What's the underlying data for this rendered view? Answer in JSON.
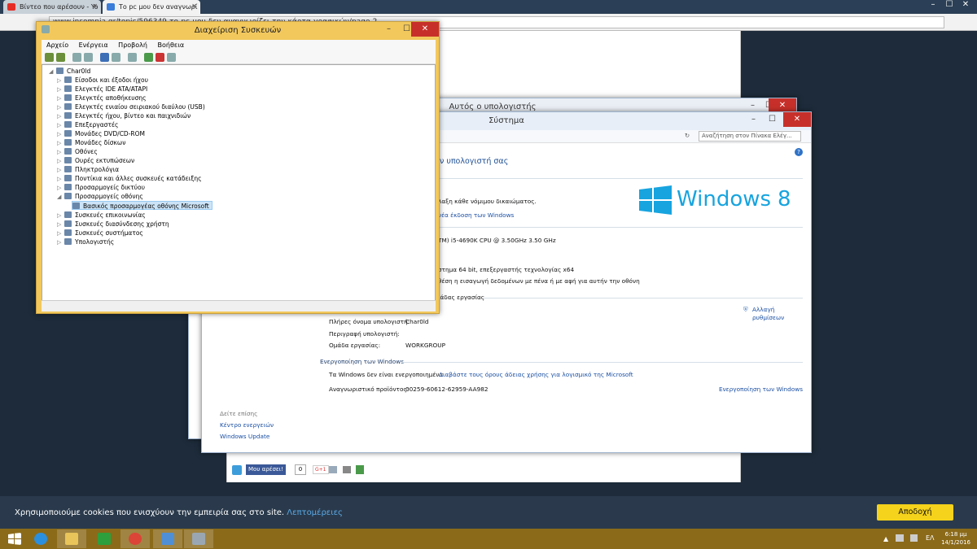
{
  "browser": {
    "tabs": [
      {
        "label": "Βίντεο που αρέσουν - Yo",
        "favicon_color": "#e52d27"
      },
      {
        "label": "Το pc μου δεν αναγνωρί",
        "favicon_color": "#3b7dd8"
      }
    ],
    "address": "www.insomnia.gr/topic/596349-το-pc-μου-δεν-αναγνωρίζει-την-κάρτα-γραφικών/page-2",
    "cookie_text": "Χρησιμοποιούμε cookies που ενισχύουν την εμπειρία σας στο site.",
    "cookie_link": "Λεπτομέρειες",
    "cookie_button": "Αποδοχή",
    "social_like": "Μου αρέσει!",
    "social_count": "0",
    "social_gplus": "G+1"
  },
  "device_manager": {
    "title": "Διαχείριση Συσκευών",
    "menu": [
      "Αρχείο",
      "Ενέργεια",
      "Προβολή",
      "Βοήθεια"
    ],
    "root": "Char0ld",
    "nodes": [
      "Είσοδοι και έξοδοι ήχου",
      "Ελεγκτές IDE ATA/ATAPI",
      "Ελεγκτές αποθήκευσης",
      "Ελεγκτές ενιαίου σειριακού διαύλου (USB)",
      "Ελεγκτές ήχου, βίντεο και παιχνιδιών",
      "Επεξεργαστές",
      "Μονάδες DVD/CD-ROM",
      "Μονάδες δίσκων",
      "Οθόνες",
      "Ουρές εκτυπώσεων",
      "Πληκτρολόγια",
      "Ποντίκια και άλλες συσκευές κατάδειξης",
      "Προσαρμογείς δικτύου",
      "Προσαρμογείς οθόνης",
      "Βασικός προσαρμογέας οθόνης Microsoft",
      "Συσκευές επικοινωνίας",
      "Συσκευές διασύνδεσης χρήστη",
      "Συσκευές συστήματος",
      "Υπολογιστής"
    ]
  },
  "this_pc": {
    "title": "Αυτός ο υπολογιστής"
  },
  "system": {
    "title": "Σύστημα",
    "search_placeholder": "Αναζήτηση στον Πίνακα Ελέγ...",
    "heading": "ν υπολογιστή σας",
    "rights": "λαξη κάθε νόμιμου δικαιώματος.",
    "new_edition": "νέα έκδοση των Windows",
    "logo": "Windows",
    "logo_ver": "8",
    "cpu": "TM) i5-4690K CPU @ 3.50GHz   3.50 GHz",
    "os_type": "στημα 64 bit, επεξεργαστής τεχνολογίας x64",
    "pen": "θέση η εισαγωγή δεδομένων με πένα ή με αφή για αυτήν την οθόνη",
    "workgroup_section": "ιάδας εργασίας",
    "change_settings": "Αλλαγή ρυθμίσεων",
    "full_name_label": "Πλήρες όνομα υπολογιστή:",
    "full_name": "Char0ld",
    "description_label": "Περιγραφή υπολογιστή:",
    "workgroup_label": "Ομάδα εργασίας:",
    "workgroup": "WORKGROUP",
    "activation_header": "Ενεργοποίηση των Windows",
    "activation_status": "Τα Windows δεν είναι ενεργοποιημένα.",
    "license_link": "Διαβάστε τους όρους άδειας χρήσης για λογισμικό της Microsoft",
    "product_id_label": "Αναγνωριστικό προϊόντος:",
    "product_id": "00259-60612-62959-AA982",
    "activate_link": "Ενεργοποίηση των Windows",
    "see_also": "Δείτε επίσης",
    "action_center": "Κέντρο ενεργειών",
    "windows_update": "Windows Update"
  },
  "taskbar": {
    "lang": "ΕΛ",
    "time": "6:18 μμ",
    "date": "14/1/2016"
  }
}
